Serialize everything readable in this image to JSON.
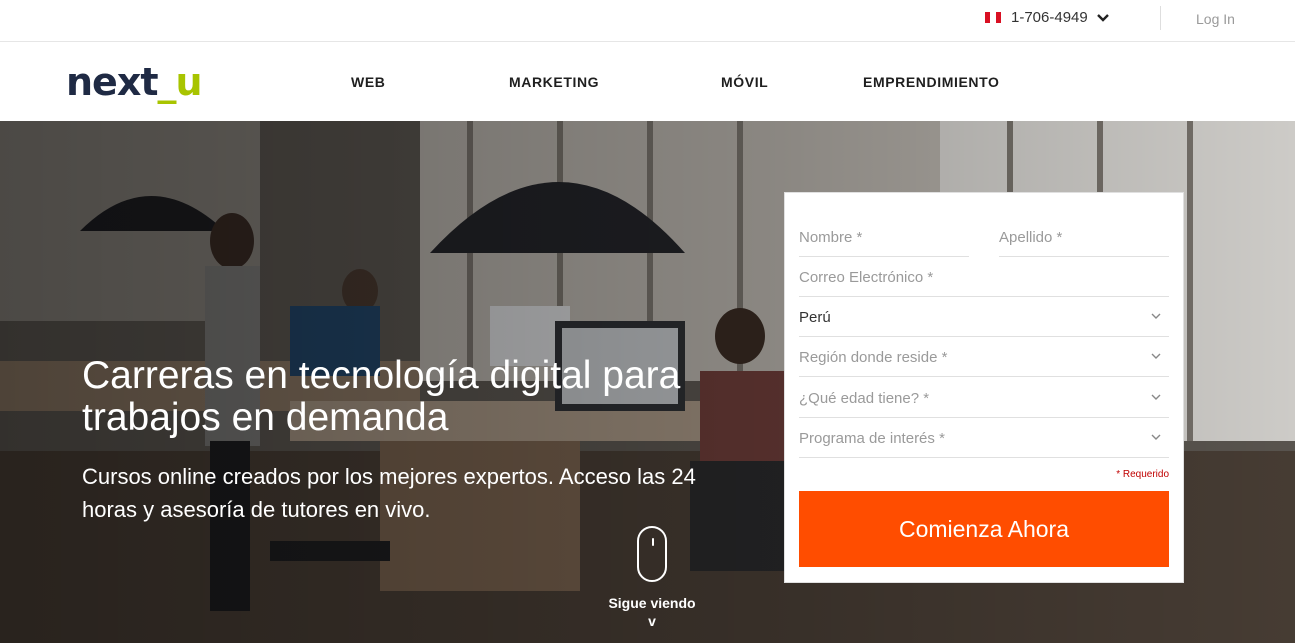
{
  "topbar": {
    "phone": "1-706-4949",
    "login": "Log In"
  },
  "brand": {
    "logo_main": "next",
    "logo_sep": "_",
    "logo_end": "u"
  },
  "nav": {
    "items": [
      "WEB",
      "MARKETING",
      "MÓVIL",
      "EMPRENDIMIENTO"
    ]
  },
  "hero": {
    "headline": "Carreras en tecnología digital para trabajos en demanda",
    "subhead": "Cursos online creados por los mejores expertos. Acceso las 24 horas y asesoría de tutores en vivo.",
    "scroll_text": "Sigue viendo",
    "scroll_v": "v"
  },
  "form": {
    "nombre": "Nombre *",
    "apellido": "Apellido *",
    "correo": "Correo Electrónico *",
    "pais": "Perú",
    "region": "Región donde reside *",
    "edad": "¿Qué edad tiene? *",
    "programa": "Programa de interés *",
    "required": "* Requerido",
    "cta": "Comienza Ahora"
  },
  "colors": {
    "brand_navy": "#1f2a44",
    "brand_lime": "#a8c400",
    "cta_orange": "#ff4d00",
    "required_red": "#c00000"
  }
}
